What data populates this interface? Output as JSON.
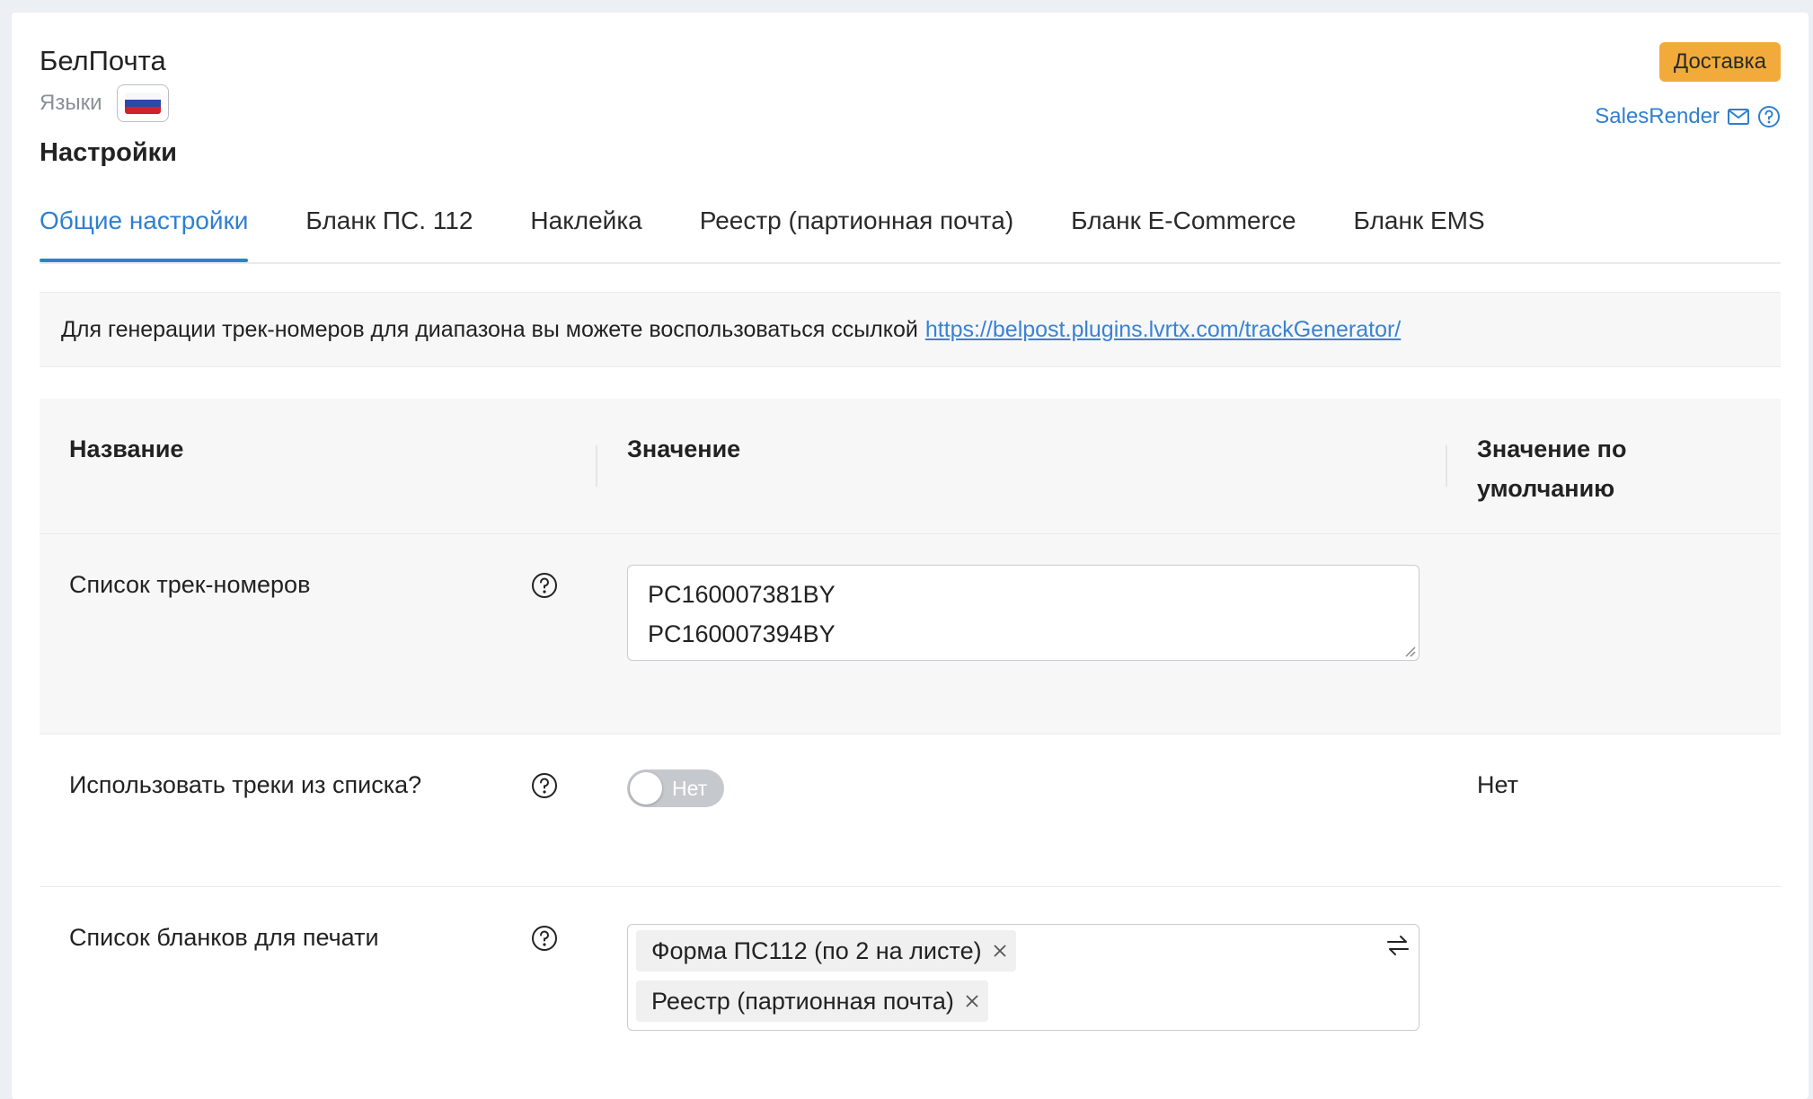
{
  "header": {
    "app_title": "БелПочта",
    "languages_label": "Языки",
    "page_title": "Настройки",
    "delivery_badge": "Доставка",
    "salesrender_link": "SalesRender"
  },
  "tabs": [
    {
      "label": "Общие настройки",
      "active": true
    },
    {
      "label": "Бланк ПС. 112",
      "active": false
    },
    {
      "label": "Наклейка",
      "active": false
    },
    {
      "label": "Реестр (партионная почта)",
      "active": false
    },
    {
      "label": "Бланк E-Commerce",
      "active": false
    },
    {
      "label": "Бланк EMS",
      "active": false
    }
  ],
  "info": {
    "text": "Для генерации трек-номеров для диапазона вы можете воспользоваться ссылкой",
    "link": "https://belpost.plugins.lvrtx.com/trackGenerator/"
  },
  "table": {
    "headers": {
      "name": "Название",
      "value": "Значение",
      "default": "Значение по умолчанию"
    },
    "rows": [
      {
        "label": "Список трек-номеров",
        "value_lines": [
          "PC160007381BY",
          "PC160007394BY"
        ],
        "default": ""
      },
      {
        "label": "Использовать треки из списка?",
        "toggle_text": "Нет",
        "toggle_on": false,
        "default": "Нет"
      },
      {
        "label": "Список бланков для печати",
        "chips": [
          "Форма ПС112 (по 2 на листе)",
          "Реестр (партионная почта)"
        ],
        "default": ""
      }
    ]
  },
  "colors": {
    "accent": "#2f7fd0",
    "badge": "#f2ab3a",
    "row_bg": "#f7f7f7"
  },
  "icons": [
    "mail-icon",
    "help-icon",
    "resize-handle-icon",
    "swap-icon",
    "close-icon"
  ]
}
